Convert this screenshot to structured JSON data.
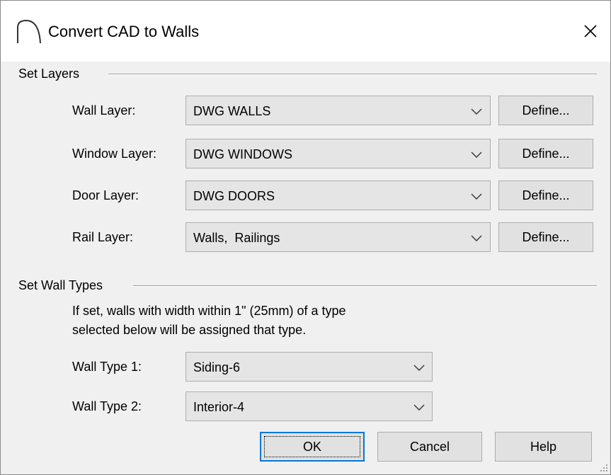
{
  "window": {
    "title": "Convert CAD to Walls",
    "close_symbol": "✕",
    "app_icon": "arc-icon"
  },
  "set_layers": {
    "header": "Set Layers",
    "rows": [
      {
        "label": "Wall Layer:",
        "value": "DWG WALLS",
        "define_label": "Define..."
      },
      {
        "label": "Window Layer:",
        "value": "DWG WINDOWS",
        "define_label": "Define..."
      },
      {
        "label": "Door Layer:",
        "value": "DWG DOORS",
        "define_label": "Define..."
      },
      {
        "label": "Rail Layer:",
        "value": "Walls,  Railings",
        "define_label": "Define..."
      }
    ]
  },
  "set_wall_types": {
    "header": "Set Wall Types",
    "hint_line1": "If set, walls with width within 1\" (25mm) of a type",
    "hint_line2": "selected below will be assigned that type.",
    "rows": [
      {
        "label": "Wall Type 1:",
        "value": "Siding-6"
      },
      {
        "label": "Wall Type 2:",
        "value": "Interior-4"
      }
    ]
  },
  "buttons": {
    "ok": "OK",
    "cancel": "Cancel",
    "help": "Help"
  },
  "colors": {
    "dialog_bg": "#f0f0f0",
    "title_bg": "#ffffff",
    "default_button_border": "#0078d7"
  }
}
